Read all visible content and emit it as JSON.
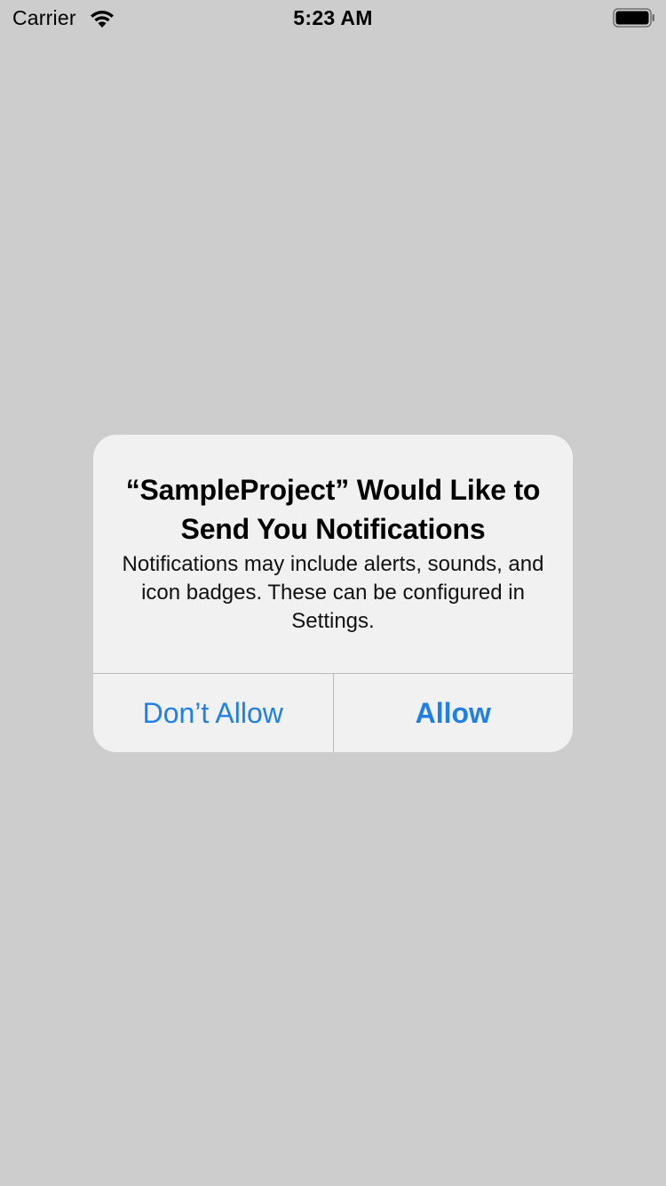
{
  "status_bar": {
    "carrier": "Carrier",
    "time": "5:23 AM",
    "wifi_icon": "wifi-icon",
    "battery_icon": "battery-icon",
    "battery_level": 1.0
  },
  "alert": {
    "title": "“SampleProject” Would Like to Send You Notifications",
    "message": "Notifications may include alerts, sounds, and icon badges. These can be configured in Settings.",
    "buttons": {
      "dont_allow": "Don’t Allow",
      "allow": "Allow"
    }
  },
  "colors": {
    "background": "#cdcdcd",
    "alert_background": "#f1f1f1",
    "accent": "#1f7ee8"
  }
}
